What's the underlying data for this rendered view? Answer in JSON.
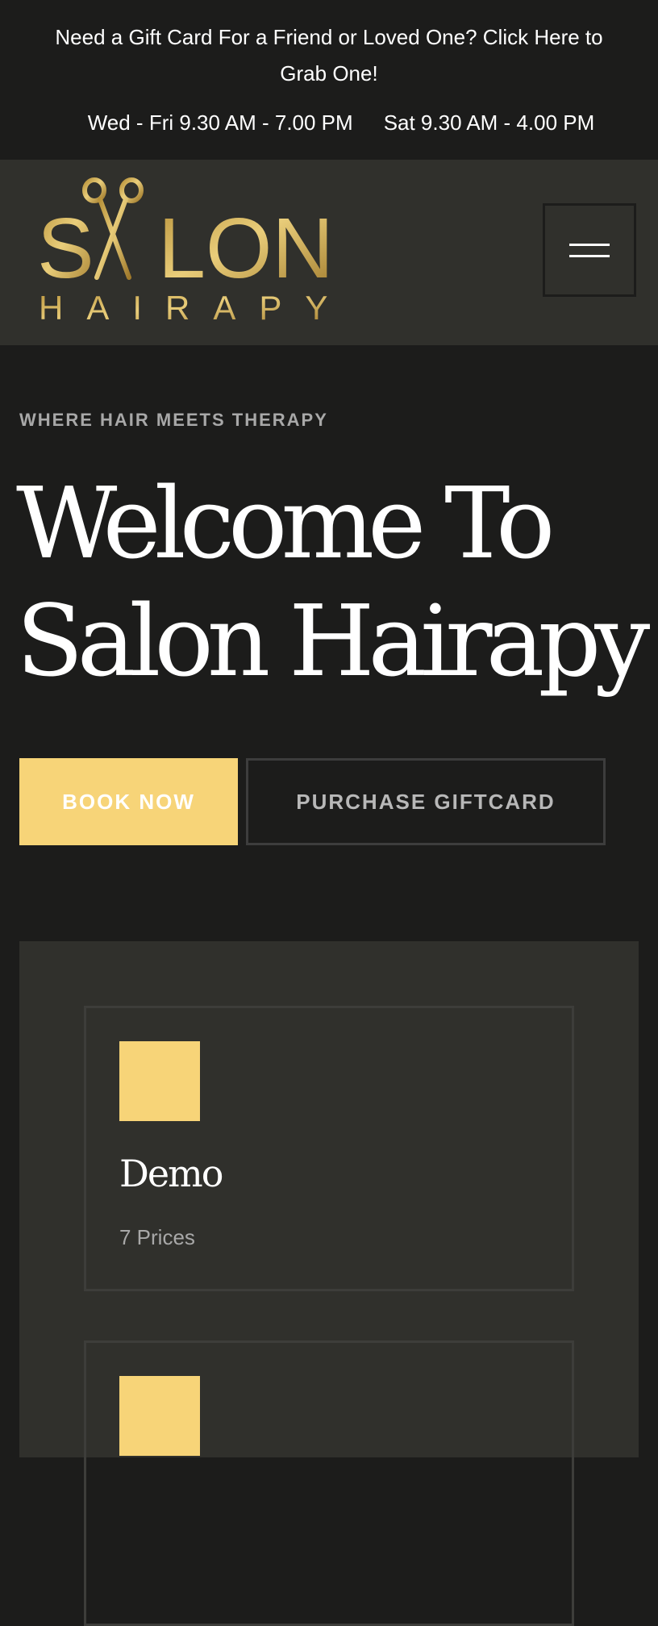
{
  "topbar": {
    "gift_text": "Need a Gift Card For a Friend or Loved One? Click Here to Grab One!",
    "hours_weekday": "Wed - Fri 9.30 AM - 7.00 PM",
    "hours_saturday": "Sat 9.30 AM - 4.00 PM"
  },
  "header": {
    "logo_word_top": "SALON",
    "logo_word_bottom": "HAIRAPY",
    "menu_icon": "hamburger-icon"
  },
  "hero": {
    "tagline": "Where hair meets therapy",
    "title_line1": "Welcome To",
    "title_line2": "Salon Hairapy",
    "book_label": "Book Now",
    "giftcard_label": "Purchase Giftcard"
  },
  "services": [
    {
      "title": "Demo",
      "subtitle": "7 Prices"
    },
    {
      "title": "",
      "subtitle": ""
    }
  ],
  "colors": {
    "background": "#1c1c1b",
    "panel": "#30302c",
    "accent_gold": "#f7d478",
    "muted_text": "#a8a8a8"
  }
}
